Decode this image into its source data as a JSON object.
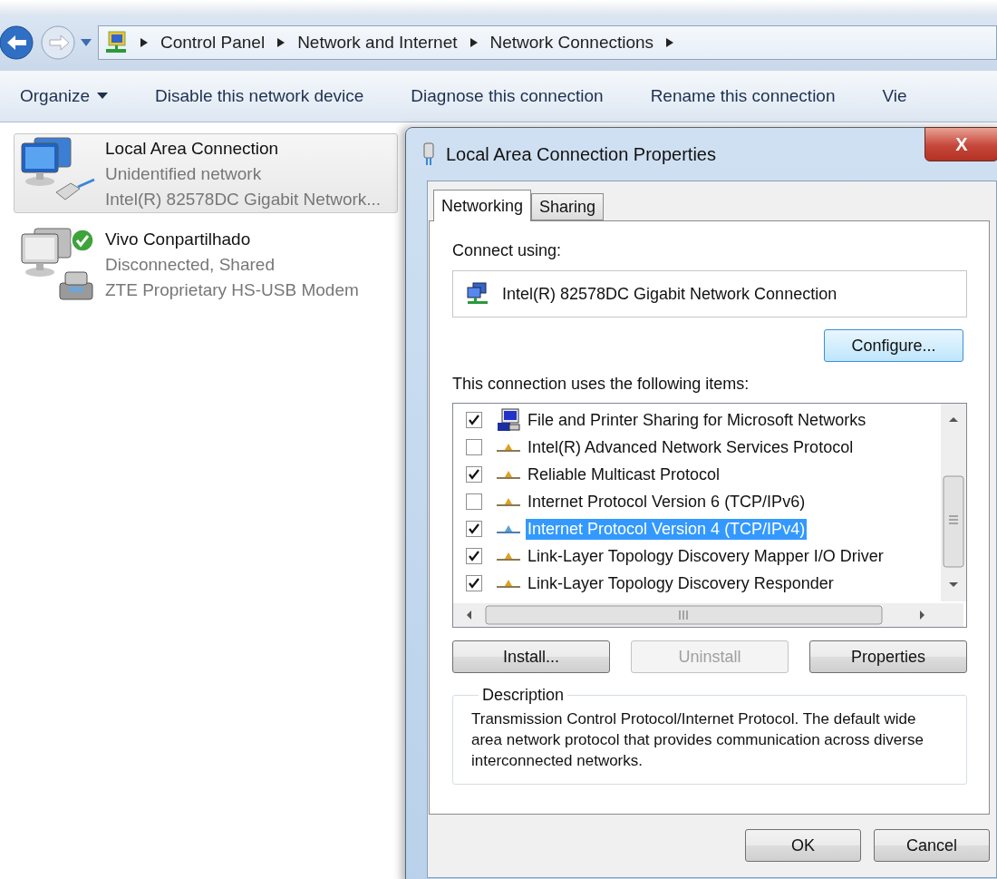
{
  "breadcrumb": [
    "Control Panel",
    "Network and Internet",
    "Network Connections"
  ],
  "toolbar": [
    {
      "label": "Organize",
      "kind": "menu"
    },
    {
      "label": "Disable this network device",
      "kind": "command"
    },
    {
      "label": "Diagnose this connection",
      "kind": "command"
    },
    {
      "label": "Rename this connection",
      "kind": "command"
    },
    {
      "label": "Vie",
      "kind": "command"
    }
  ],
  "connections": [
    {
      "name": "Local Area Connection",
      "status": "Unidentified network",
      "device": "Intel(R) 82578DC Gigabit Network...",
      "kind": "ethernet",
      "selected": true,
      "shared_ok": false
    },
    {
      "name": "Vivo Conpartilhado",
      "status": "Disconnected, Shared",
      "device": "ZTE Proprietary HS-USB Modem",
      "kind": "modem",
      "selected": false,
      "shared_ok": true
    }
  ],
  "dialog": {
    "title": "Local Area Connection Properties",
    "close": "X",
    "tabs": [
      {
        "label": "Networking",
        "selected": true
      },
      {
        "label": "Sharing",
        "selected": false
      }
    ],
    "connect_label": "Connect using:",
    "adapter": "Intel(R) 82578DC Gigabit Network Connection",
    "configure": "Configure...",
    "items_label": "This connection uses the following items:",
    "items": [
      {
        "label": "File and Printer Sharing for Microsoft Networks",
        "kind": "service",
        "checked": true,
        "selected": false
      },
      {
        "label": "Intel(R) Advanced Network Services Protocol",
        "kind": "protocol",
        "checked": false,
        "selected": false
      },
      {
        "label": "Reliable Multicast Protocol",
        "kind": "protocol",
        "checked": true,
        "selected": false
      },
      {
        "label": "Internet Protocol Version 6 (TCP/IPv6)",
        "kind": "protocol",
        "checked": false,
        "selected": false
      },
      {
        "label": "Internet Protocol Version 4 (TCP/IPv4)",
        "kind": "protocol",
        "checked": true,
        "selected": true
      },
      {
        "label": "Link-Layer Topology Discovery Mapper I/O Driver",
        "kind": "protocol",
        "checked": true,
        "selected": false
      },
      {
        "label": "Link-Layer Topology Discovery Responder",
        "kind": "protocol",
        "checked": true,
        "selected": false
      }
    ],
    "actions": [
      {
        "label": "Install...",
        "disabled": false
      },
      {
        "label": "Uninstall",
        "disabled": true
      },
      {
        "label": "Properties",
        "disabled": false
      }
    ],
    "description_title": "Description",
    "description": "Transmission Control Protocol/Internet Protocol. The default wide area network protocol that provides communication across diverse interconnected networks.",
    "buttons": [
      "OK",
      "Cancel"
    ]
  }
}
